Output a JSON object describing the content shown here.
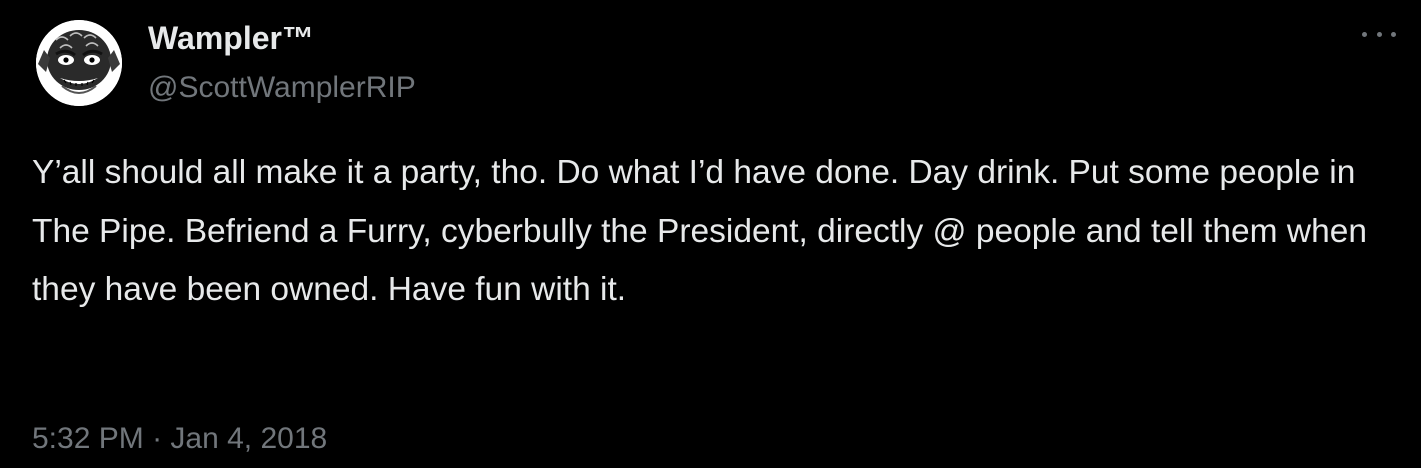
{
  "tweet": {
    "author": {
      "display_name": "Wampler™",
      "handle": "@ScottWamplerRIP",
      "avatar_icon": "creature-avatar"
    },
    "more_icon": "more-options-icon",
    "text": "Y’all should all make it a party, tho. Do what I’d have done. Day drink. Put some people in The Pipe. Befriend a Furry, cyberbully the President, directly @ people and tell them when they have been owned. Have fun with it.",
    "time": "5:32 PM",
    "separator": " · ",
    "date": "Jan 4, 2018"
  },
  "colors": {
    "background": "#000000",
    "primary_text": "#e7e9ea",
    "secondary_text": "#71767b"
  }
}
